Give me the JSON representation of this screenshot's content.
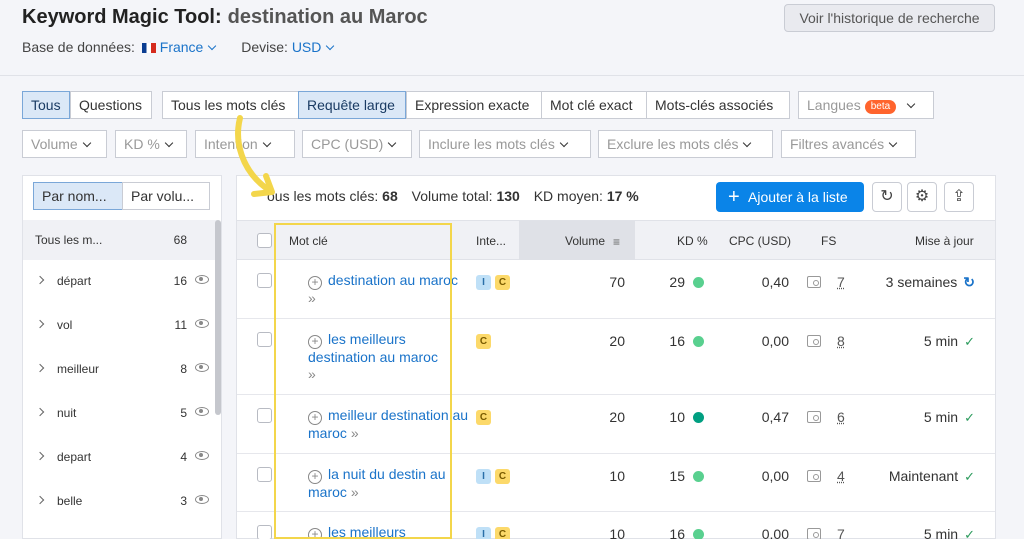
{
  "header": {
    "title": "Keyword Magic Tool:",
    "query": "destination au Maroc",
    "history_button": "Voir l'historique de recherche",
    "db_label": "Base de données:",
    "db_value": "France",
    "currency_label": "Devise:",
    "currency_value": "USD"
  },
  "filters_row1": {
    "tous": "Tous",
    "questions": "Questions",
    "tous_mots": "Tous les mots clés",
    "requete_large": "Requête large",
    "expression_exacte": "Expression exacte",
    "mot_exact": "Mot clé exact",
    "associes": "Mots-clés associés",
    "langues": "Langues",
    "beta": "beta"
  },
  "filters_row2": {
    "volume": "Volume",
    "kd": "KD %",
    "intention": "Intention",
    "cpc": "CPC (USD)",
    "inclure": "Inclure les mots clés",
    "exclure": "Exclure les mots clés",
    "avances": "Filtres avancés"
  },
  "sidebar": {
    "tab_name": "Par nom...",
    "tab_volume": "Par volu...",
    "all_label": "Tous les m...",
    "all_count": "68",
    "items": [
      {
        "label": "départ",
        "count": "16"
      },
      {
        "label": "vol",
        "count": "11"
      },
      {
        "label": "meilleur",
        "count": "8"
      },
      {
        "label": "nuit",
        "count": "5"
      },
      {
        "label": "depart",
        "count": "4"
      },
      {
        "label": "belle",
        "count": "3"
      }
    ]
  },
  "summary": {
    "all_kw_label": "ous les mots clés:",
    "all_kw_value": "68",
    "volume_label": "Volume total:",
    "volume_value": "130",
    "kd_label": "KD moyen:",
    "kd_value": "17 %",
    "add_button": "Ajouter à la liste"
  },
  "table": {
    "headers": {
      "keyword": "Mot clé",
      "intent": "Inte...",
      "volume": "Volume",
      "kd": "KD %",
      "cpc": "CPC (USD)",
      "fs": "FS",
      "updated": "Mise à jour"
    },
    "rows": [
      {
        "kw1": "destination au maroc",
        "kw2": "",
        "intent": [
          "I",
          "C"
        ],
        "volume": "70",
        "kd": "29",
        "kd_color": "#59d08f",
        "cpc": "0,40",
        "fs": "7",
        "updated": "3 semaines"
      },
      {
        "kw1": "les meilleurs",
        "kw2": "destination au maroc",
        "intent": [
          "C"
        ],
        "volume": "20",
        "kd": "16",
        "kd_color": "#59d08f",
        "cpc": "0,00",
        "fs": "8",
        "updated": "5 min"
      },
      {
        "kw1": "meilleur destination au",
        "kw2": "maroc",
        "intent": [
          "C"
        ],
        "volume": "20",
        "kd": "10",
        "kd_color": "#009f81",
        "cpc": "0,47",
        "fs": "6",
        "updated": "5 min"
      },
      {
        "kw1": "la nuit du destin au",
        "kw2": "maroc",
        "intent": [
          "I",
          "C"
        ],
        "volume": "10",
        "kd": "15",
        "kd_color": "#59d08f",
        "cpc": "0,00",
        "fs": "4",
        "updated": "Maintenant"
      },
      {
        "kw1": "les meilleurs",
        "kw2": "",
        "intent": [
          "I",
          "C"
        ],
        "volume": "10",
        "kd": "16",
        "kd_color": "#59d08f",
        "cpc": "0,00",
        "fs": "7",
        "updated": "5 min"
      }
    ]
  }
}
